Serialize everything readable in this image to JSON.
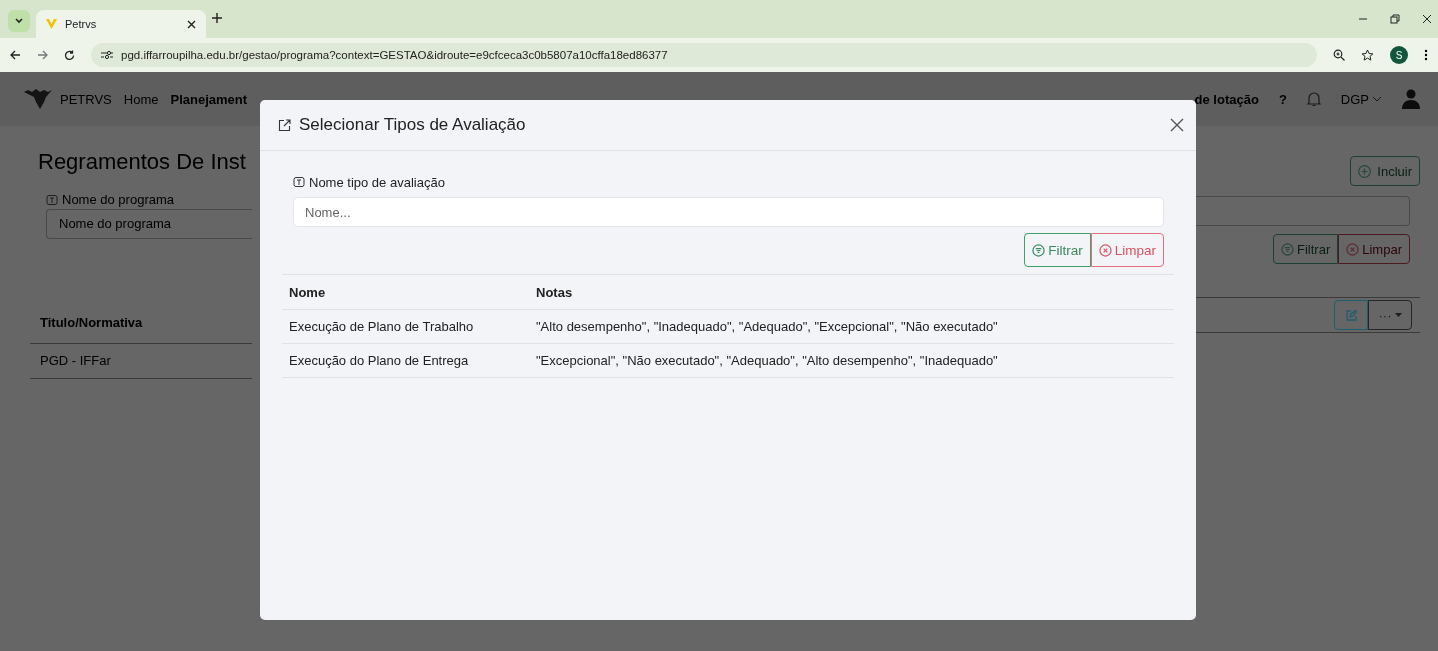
{
  "browser": {
    "tab_title": "Petrvs",
    "url": "pgd.iffarroupilha.edu.br/gestao/programa?context=GESTAO&idroute=e9cfceca3c0b5807a10cffa18ed86377",
    "profile_initial": "S"
  },
  "navbar": {
    "brand": "PETRVS",
    "items": [
      {
        "label": "Home",
        "selected": false
      },
      {
        "label": "Planejament",
        "selected": true
      }
    ],
    "notice": "de lotação",
    "help": "?",
    "unit": "DGP"
  },
  "page": {
    "title": "Regramentos De Inst",
    "field_label": "Nome do programa",
    "field_placeholder": "Nome do programa",
    "add_button": "Incluir",
    "filter_button": "Filtrar",
    "clear_button": "Limpar",
    "column": "Titulo/Normativa",
    "rows": [
      "PGD - IFFar"
    ],
    "more_label": "···"
  },
  "modal": {
    "title": "Selecionar Tipos de Avaliação",
    "field_label": "Nome tipo de avaliação",
    "field_placeholder": "Nome...",
    "filter_button": "Filtrar",
    "clear_button": "Limpar",
    "columns": [
      "Nome",
      "Notas"
    ],
    "rows": [
      {
        "nome": "Execução de Plano de Trabalho",
        "notas": "\"Alto desempenho\", \"Inadequado\", \"Adequado\", \"Excepcional\", \"Não executado\""
      },
      {
        "nome": "Execução do Plano de Entrega",
        "notas": "\"Excepcional\", \"Não executado\", \"Adequado\", \"Alto desempenho\", \"Inadequado\""
      }
    ]
  }
}
